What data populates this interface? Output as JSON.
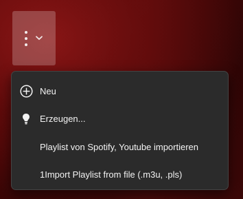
{
  "toolbar": {
    "more_button_icon": "more-vertical-icon",
    "dropdown_icon": "chevron-down-icon"
  },
  "menu": {
    "items": [
      {
        "label": "Neu",
        "icon": "add-circle-icon"
      },
      {
        "label": "Erzeugen...",
        "icon": "lightbulb-icon"
      },
      {
        "label": "Playlist von Spotify, Youtube importieren",
        "icon": ""
      },
      {
        "label": "1Import Playlist from file (.m3u, .pls)",
        "icon": ""
      }
    ]
  },
  "colors": {
    "menu_background": "#2b2b2b",
    "menu_text": "#f3f3f3",
    "background_accent": "#8a1414"
  }
}
